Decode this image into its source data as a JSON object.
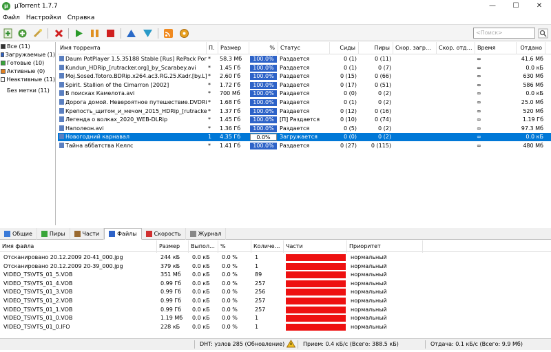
{
  "window": {
    "title": "µTorrent 1.7.7",
    "minimize": "—",
    "maximize": "☐",
    "close": "✕"
  },
  "menu": [
    "Файл",
    "Настройки",
    "Справка"
  ],
  "search": {
    "placeholder": "<Поиск>"
  },
  "sidebar": {
    "items": [
      {
        "label": "Все (11)",
        "color": "#333333"
      },
      {
        "label": "Загружаемые (1)",
        "color": "#2e63c8"
      },
      {
        "label": "Готовые (10)",
        "color": "#3aa53a"
      },
      {
        "label": "Активные (0)",
        "color": "#e08020"
      },
      {
        "label": "Неактивные (11)",
        "color": "#ffffff"
      }
    ],
    "labels_item": "Без метки (11)"
  },
  "torrent_headers": [
    "Имя торрента",
    "П.",
    "Размер",
    "%",
    "Статус",
    "Сиды",
    "Пиры",
    "Скор. загр…",
    "Скор. отд…",
    "Время",
    "Отдано"
  ],
  "torrents": [
    {
      "name": "Daum PotPlayer 1.5.35188 Stable [Rus] RePack Por…",
      "prio": "*",
      "size": "58.3 Мб",
      "pct": "100.0%",
      "progress": 1.0,
      "status": "Раздается",
      "seeds": "0 (1)",
      "peers": "0 (11)",
      "eta": "∞",
      "uploaded": "41.6 Мб"
    },
    {
      "name": "Kundun_HDRip_[rutracker.org]_by_Scarabey.avi",
      "prio": "*",
      "size": "1.45 Гб",
      "pct": "100.0%",
      "progress": 1.0,
      "status": "Раздается",
      "seeds": "0 (1)",
      "peers": "0 (7)",
      "eta": "∞",
      "uploaded": "0.0 кБ"
    },
    {
      "name": "Moj.Sosed.Totoro.BDRip.x264.ac3.RG.25.Kadr.[by.L]",
      "prio": "*",
      "size": "2.60 Гб",
      "pct": "100.0%",
      "progress": 1.0,
      "status": "Раздается",
      "seeds": "0 (15)",
      "peers": "0 (66)",
      "eta": "∞",
      "uploaded": "630 Мб"
    },
    {
      "name": "Spirit. Stallion of the Cimarron [2002]",
      "prio": "*",
      "size": "1.72 Гб",
      "pct": "100.0%",
      "progress": 1.0,
      "status": "Раздается",
      "seeds": "0 (17)",
      "peers": "0 (51)",
      "eta": "∞",
      "uploaded": "586 Мб"
    },
    {
      "name": "В поисках Камелота.avi",
      "prio": "*",
      "size": "700 Мб",
      "pct": "100.0%",
      "progress": 1.0,
      "status": "Раздается",
      "seeds": "0 (0)",
      "peers": "0 (2)",
      "eta": "∞",
      "uploaded": "0.0 кБ"
    },
    {
      "name": "Дорога домой. Невероятное путешествие.DVDRi…",
      "prio": "*",
      "size": "1.68 Гб",
      "pct": "100.0%",
      "progress": 1.0,
      "status": "Раздается",
      "seeds": "0 (1)",
      "peers": "0 (2)",
      "eta": "∞",
      "uploaded": "25.0 Мб"
    },
    {
      "name": "Крепость_щитом_и_мечом_2015_HDRip_[rutracker…",
      "prio": "*",
      "size": "1.37 Гб",
      "pct": "100.0%",
      "progress": 1.0,
      "status": "Раздается",
      "seeds": "0 (12)",
      "peers": "0 (16)",
      "eta": "∞",
      "uploaded": "520 Мб"
    },
    {
      "name": "Легенда о волках_2020_WEB-DLRip",
      "prio": "*",
      "size": "1.45 Гб",
      "pct": "100.0%",
      "progress": 1.0,
      "status": "[П] Раздается",
      "seeds": "0 (10)",
      "peers": "0 (74)",
      "eta": "∞",
      "uploaded": "1.19 Гб"
    },
    {
      "name": "Наполеон.avi",
      "prio": "*",
      "size": "1.36 Гб",
      "pct": "100.0%",
      "progress": 1.0,
      "status": "Раздается",
      "seeds": "0 (5)",
      "peers": "0 (2)",
      "eta": "∞",
      "uploaded": "97.3 Мб"
    },
    {
      "name": "Новогодний карнавал",
      "prio": "1",
      "size": "4.35 Гб",
      "pct": "0.0%",
      "progress": 0.0,
      "status": "Загружается",
      "seeds": "0 (0)",
      "peers": "0 (2)",
      "eta": "∞",
      "uploaded": "0.0 кБ",
      "selected": true
    },
    {
      "name": "Тайна аббатства Келлс",
      "prio": "*",
      "size": "1.41 Гб",
      "pct": "100.0%",
      "progress": 1.0,
      "status": "Раздается",
      "seeds": "0 (27)",
      "peers": "0 (115)",
      "eta": "∞",
      "uploaded": "480 Мб"
    }
  ],
  "tabs": [
    {
      "label": "Общие",
      "icon": "info-icon"
    },
    {
      "label": "Пиры",
      "icon": "peers-icon"
    },
    {
      "label": "Части",
      "icon": "pieces-icon"
    },
    {
      "label": "Файлы",
      "icon": "files-icon",
      "active": true
    },
    {
      "label": "Скорость",
      "icon": "speed-icon"
    },
    {
      "label": "Журнал",
      "icon": "log-icon"
    }
  ],
  "file_headers": [
    "Имя файла",
    "Размер",
    "Выпол…",
    "%",
    "Количе…",
    "Части",
    "Приоритет"
  ],
  "files": [
    {
      "name": "Отсканировано 20.12.2009 20-41_000.jpg",
      "size": "244 кБ",
      "done": "0.0 кБ",
      "pct": "0.0 %",
      "count": "1",
      "priority": "нормальный"
    },
    {
      "name": "Отсканировано 20.12.2009 20-39_000.jpg",
      "size": "379 кБ",
      "done": "0.0 кБ",
      "pct": "0.0 %",
      "count": "1",
      "priority": "нормальный"
    },
    {
      "name": "VIDEO_TS\\VTS_01_5.VOB",
      "size": "351 Мб",
      "done": "0.0 кБ",
      "pct": "0.0 %",
      "count": "89",
      "priority": "нормальный"
    },
    {
      "name": "VIDEO_TS\\VTS_01_4.VOB",
      "size": "0.99 Гб",
      "done": "0.0 кБ",
      "pct": "0.0 %",
      "count": "257",
      "priority": "нормальный"
    },
    {
      "name": "VIDEO_TS\\VTS_01_3.VOB",
      "size": "0.99 Гб",
      "done": "0.0 кБ",
      "pct": "0.0 %",
      "count": "256",
      "priority": "нормальный"
    },
    {
      "name": "VIDEO_TS\\VTS_01_2.VOB",
      "size": "0.99 Гб",
      "done": "0.0 кБ",
      "pct": "0.0 %",
      "count": "257",
      "priority": "нормальный"
    },
    {
      "name": "VIDEO_TS\\VTS_01_1.VOB",
      "size": "0.99 Гб",
      "done": "0.0 кБ",
      "pct": "0.0 %",
      "count": "257",
      "priority": "нормальный"
    },
    {
      "name": "VIDEO_TS\\VTS_01_0.VOB",
      "size": "1.19 Мб",
      "done": "0.0 кБ",
      "pct": "0.0 %",
      "count": "1",
      "priority": "нормальный"
    },
    {
      "name": "VIDEO_TS\\VTS_01_0.IFO",
      "size": "228 кБ",
      "done": "0.0 кБ",
      "pct": "0.0 %",
      "count": "1",
      "priority": "нормальный"
    }
  ],
  "status": {
    "dht": "DHT: узлов 285  (Обновление)",
    "download": "Прием: 0.4 кБ/с (Всего: 388.5 кБ)",
    "upload": "Отдача: 0.1 кБ/с (Всего: 9.9 Мб)"
  },
  "colors": {
    "accent": "#0078d7",
    "progress": "#2e63c8",
    "pieces": "#ee1111"
  }
}
